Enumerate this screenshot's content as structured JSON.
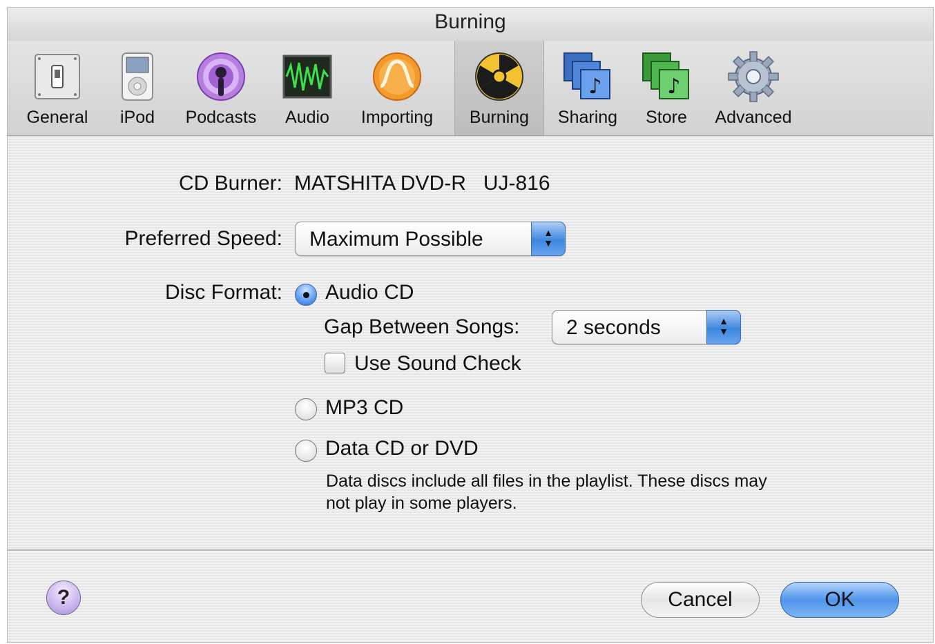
{
  "window": {
    "title": "Burning"
  },
  "toolbar": {
    "items": [
      {
        "label": "General",
        "icon": "general-switch-icon"
      },
      {
        "label": "iPod",
        "icon": "ipod-icon"
      },
      {
        "label": "Podcasts",
        "icon": "podcast-icon"
      },
      {
        "label": "Audio",
        "icon": "audio-waveform-icon"
      },
      {
        "label": "Importing",
        "icon": "importing-icon"
      },
      {
        "label": "Burning",
        "icon": "burn-radiation-icon",
        "selected": true
      },
      {
        "label": "Sharing",
        "icon": "sharing-icon"
      },
      {
        "label": "Store",
        "icon": "store-icon"
      },
      {
        "label": "Advanced",
        "icon": "gear-icon"
      }
    ]
  },
  "form": {
    "cd_burner_label": "CD Burner:",
    "cd_burner_value": "MATSHITA DVD-R   UJ-816",
    "preferred_speed_label": "Preferred Speed:",
    "preferred_speed_value": "Maximum Possible",
    "disc_format_label": "Disc Format:",
    "options": {
      "audio_cd": {
        "label": "Audio CD",
        "selected": true
      },
      "gap_label": "Gap Between Songs:",
      "gap_value": "2 seconds",
      "sound_check_label": "Use Sound Check",
      "sound_check_checked": false,
      "mp3_cd": {
        "label": "MP3 CD",
        "selected": false
      },
      "data_cd": {
        "label": "Data CD or DVD",
        "selected": false
      },
      "data_note": "Data discs include all files in the playlist. These discs may not play in some players."
    }
  },
  "buttons": {
    "help": "?",
    "cancel": "Cancel",
    "ok": "OK"
  },
  "colors": {
    "accent_blue": "#4f95ec",
    "window_bg": "#ebebeb"
  }
}
